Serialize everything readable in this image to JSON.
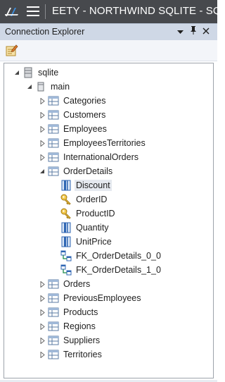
{
  "window": {
    "title": "EETY - NORTHWIND SQLITE - SQL"
  },
  "panel": {
    "title": "Connection Explorer",
    "dropdown_icon": "caret-down-icon",
    "pin_icon": "pin-icon",
    "close_icon": "close-icon"
  },
  "toolbar": {
    "edit_icon": "edit-connection-icon"
  },
  "tree": {
    "root": {
      "label": "sqlite",
      "icon": "database-icon",
      "expanded": true
    },
    "schema": {
      "label": "main",
      "icon": "schema-icon",
      "expanded": true
    },
    "tables_before": [
      {
        "label": "Categories"
      },
      {
        "label": "Customers"
      },
      {
        "label": "Employees"
      },
      {
        "label": "EmployeesTerritories"
      },
      {
        "label": "InternationalOrders"
      }
    ],
    "expanded_table": {
      "label": "OrderDetails",
      "children": [
        {
          "label": "Discount",
          "kind": "column",
          "selected": true
        },
        {
          "label": "OrderID",
          "kind": "key"
        },
        {
          "label": "ProductID",
          "kind": "key"
        },
        {
          "label": "Quantity",
          "kind": "column"
        },
        {
          "label": "UnitPrice",
          "kind": "column"
        },
        {
          "label": "FK_OrderDetails_0_0",
          "kind": "foreign-key"
        },
        {
          "label": "FK_OrderDetails_1_0",
          "kind": "foreign-key"
        }
      ]
    },
    "tables_after": [
      {
        "label": "Orders"
      },
      {
        "label": "PreviousEmployees"
      },
      {
        "label": "Products"
      },
      {
        "label": "Regions"
      },
      {
        "label": "Suppliers"
      },
      {
        "label": "Territories"
      }
    ]
  }
}
